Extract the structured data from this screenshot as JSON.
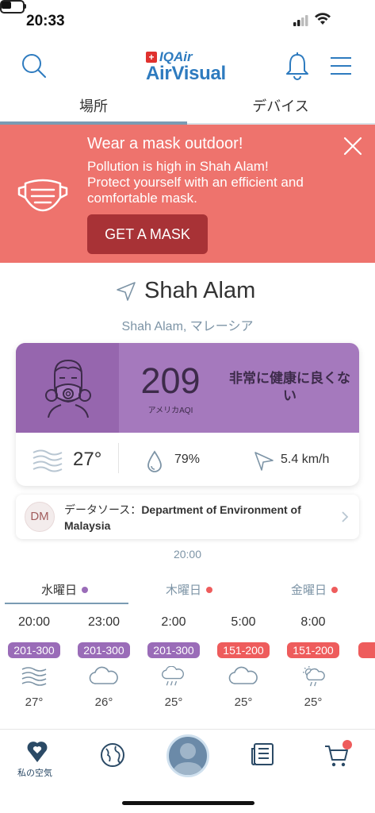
{
  "status_bar": {
    "time": "20:33"
  },
  "header": {
    "logo_brand": "IQAir",
    "logo_app": "AirVisual",
    "icons": [
      "search-icon",
      "bell-icon",
      "menu-icon"
    ]
  },
  "tabs": [
    {
      "label": "場所",
      "active": true
    },
    {
      "label": "デバイス",
      "active": false
    }
  ],
  "banner": {
    "title": "Wear a mask outdoor!",
    "lines": [
      "Pollution is high in Shah Alam!",
      "Protect yourself with an efficient and",
      "comfortable mask."
    ],
    "button": "GET A MASK",
    "color": "#ee736d",
    "button_color": "#a83236"
  },
  "location": {
    "city": "Shah Alam",
    "sub": "Shah Alam, マレーシア"
  },
  "aqi": {
    "value": "209",
    "label": "アメリカAQI",
    "status": "非常に健康に良くない",
    "color": "#a579bd"
  },
  "weather": {
    "temperature": "27°",
    "humidity": "79%",
    "wind": "5.4 km/h"
  },
  "source": {
    "initials": "DM",
    "prefix": "データソース：",
    "name": "Department of Environment of Malaysia"
  },
  "updated_time": "20:00",
  "days": [
    {
      "label": "水曜日",
      "dot_color": "#9a6cb8",
      "active": true
    },
    {
      "label": "木曜日",
      "dot_color": "#ee5c5c",
      "active": false
    },
    {
      "label": "金曜日",
      "dot_color": "#ee5c5c",
      "active": false
    }
  ],
  "forecast": [
    {
      "time": "20:00",
      "range": "201-300",
      "color": "#9a6cb8",
      "icon": "haze-icon",
      "temp": "27°"
    },
    {
      "time": "23:00",
      "range": "201-300",
      "color": "#9a6cb8",
      "icon": "cloud-icon",
      "temp": "26°"
    },
    {
      "time": "2:00",
      "range": "201-300",
      "color": "#9a6cb8",
      "icon": "rain-cloud-icon",
      "temp": "25°"
    },
    {
      "time": "5:00",
      "range": "151-200",
      "color": "#ee5c5c",
      "icon": "cloud-icon",
      "temp": "25°"
    },
    {
      "time": "8:00",
      "range": "151-200",
      "color": "#ee5c5c",
      "icon": "sun-rain-icon",
      "temp": "25°"
    }
  ],
  "bottom_nav": [
    {
      "label": "私の空気",
      "icon": "heart-location-icon"
    },
    {
      "label": "",
      "icon": "globe-icon"
    },
    {
      "label": "",
      "icon": "profile-avatar"
    },
    {
      "label": "",
      "icon": "news-icon"
    },
    {
      "label": "",
      "icon": "cart-icon"
    }
  ]
}
